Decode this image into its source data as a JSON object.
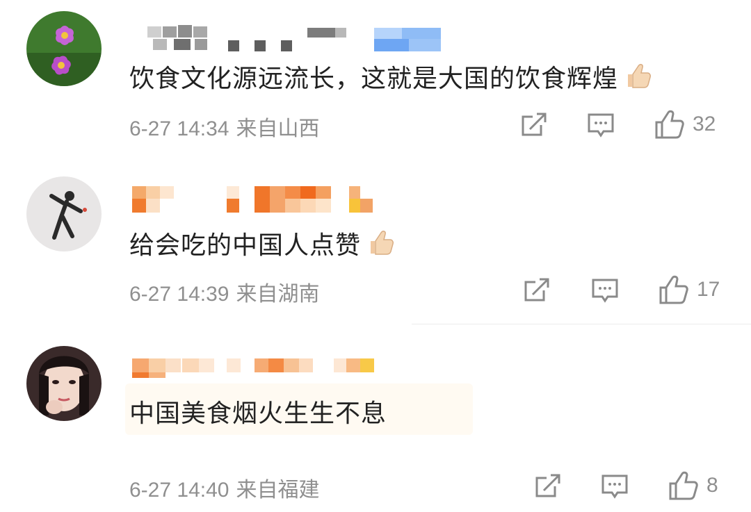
{
  "comments": [
    {
      "text": "饮食文化源远流长，这就是大国的饮食辉煌",
      "time": "6-27 14:34",
      "region": "来自山西",
      "likes": "32",
      "avatar_icon": "pink-flower-avatar",
      "has_thumb_emoji": true
    },
    {
      "text": "给会吃的中国人点赞",
      "time": "6-27 14:39",
      "region": "来自湖南",
      "likes": "17",
      "avatar_icon": "dancer-avatar",
      "has_thumb_emoji": true
    },
    {
      "text": "中国美食烟火生生不息",
      "time": "6-27 14:40",
      "region": "来自福建",
      "likes": "8",
      "avatar_icon": "girl-portrait-avatar",
      "has_thumb_emoji": false
    }
  ],
  "icons": {
    "share": "share-icon",
    "comment": "comment-icon",
    "like": "thumbs-up-icon"
  },
  "colors": {
    "text": "#222222",
    "meta": "#8f8f8f",
    "icon": "#8a8a8a"
  }
}
